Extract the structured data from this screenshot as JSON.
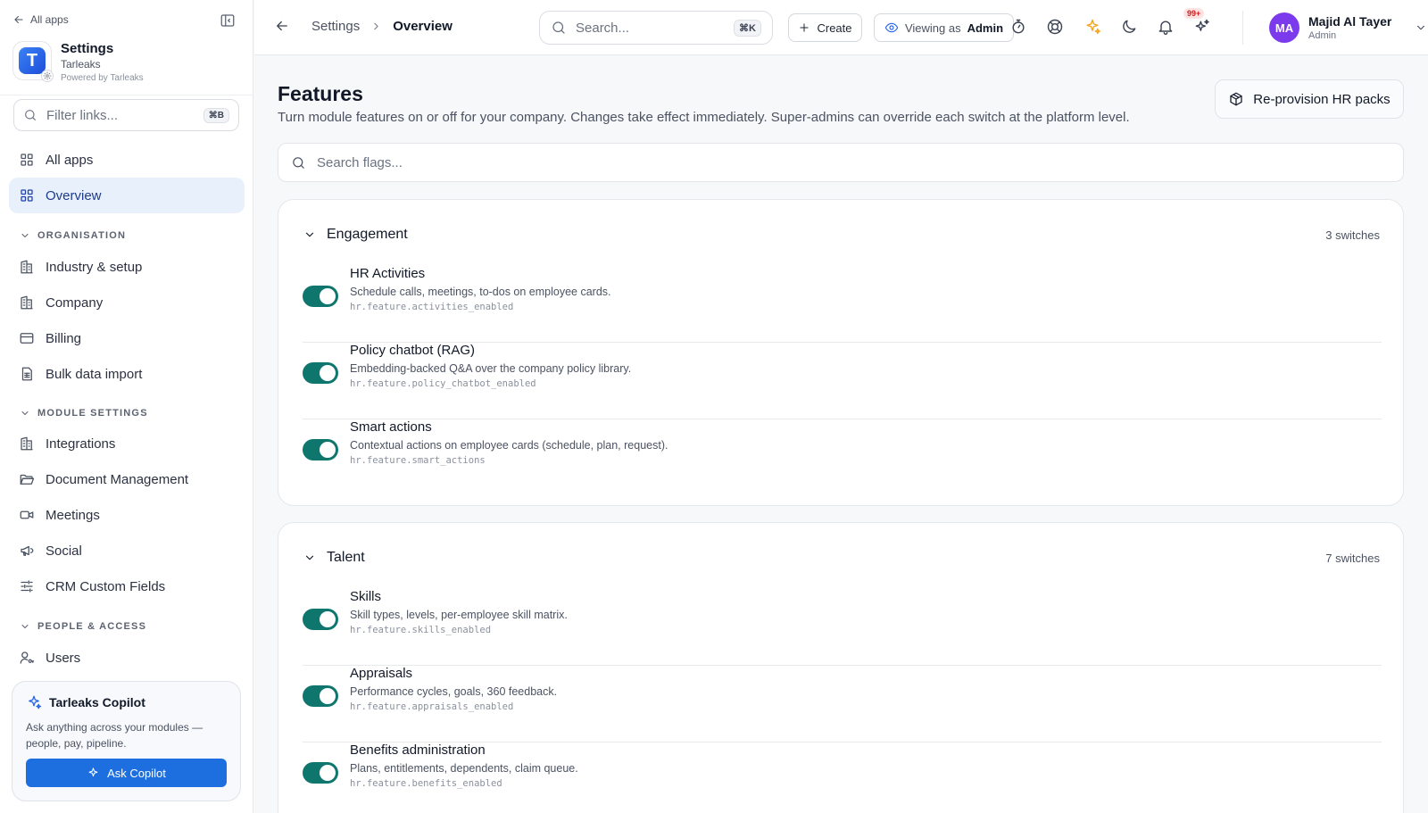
{
  "sidebar": {
    "back_label": "All apps",
    "brand": {
      "title": "Settings",
      "org": "Tarleaks",
      "powered": "Powered by Tarleaks",
      "logo_letter": "T"
    },
    "filter": {
      "placeholder": "Filter links...",
      "shortcut": "⌘B"
    },
    "items_top": [
      {
        "label": "All apps",
        "icon": "grid-icon"
      },
      {
        "label": "Overview",
        "icon": "grid-icon",
        "active": true
      }
    ],
    "sections": [
      {
        "label": "ORGANISATION",
        "items": [
          "Industry & setup",
          "Company",
          "Billing",
          "Bulk data import"
        ]
      },
      {
        "label": "MODULE SETTINGS",
        "items": [
          "Integrations",
          "Document Management",
          "Meetings",
          "Social",
          "CRM Custom Fields"
        ]
      },
      {
        "label": "PEOPLE & ACCESS",
        "items": [
          "Users"
        ]
      }
    ],
    "copilot": {
      "title": "Tarleaks Copilot",
      "description": "Ask anything across your modules — people, pay, pipeline.",
      "button": "Ask Copilot"
    }
  },
  "topbar": {
    "breadcrumb": [
      "Settings",
      "Overview"
    ],
    "search": {
      "placeholder": "Search...",
      "shortcut": "⌘K"
    },
    "create_label": "Create",
    "viewing_label": "Viewing as",
    "viewing_role": "Admin",
    "notification_count": "99+",
    "user": {
      "initials": "MA",
      "name": "Majid Al Tayer",
      "role": "Admin"
    }
  },
  "main": {
    "title": "Features",
    "description": "Turn module features on or off for your company. Changes take effect immediately. Super-admins can override each switch at the platform level.",
    "reprovision_label": "Re-provision HR packs",
    "flag_search_placeholder": "Search flags...",
    "groups": [
      {
        "name": "Engagement",
        "count": "3 switches",
        "flags": [
          {
            "name": "HR Activities",
            "desc": "Schedule calls, meetings, to-dos on employee cards.",
            "key": "hr.feature.activities_enabled",
            "on": true
          },
          {
            "name": "Policy chatbot (RAG)",
            "desc": "Embedding-backed Q&A over the company policy library.",
            "key": "hr.feature.policy_chatbot_enabled",
            "on": true
          },
          {
            "name": "Smart actions",
            "desc": "Contextual actions on employee cards (schedule, plan, request).",
            "key": "hr.feature.smart_actions",
            "on": true
          }
        ]
      },
      {
        "name": "Talent",
        "count": "7 switches",
        "flags": [
          {
            "name": "Skills",
            "desc": "Skill types, levels, per-employee skill matrix.",
            "key": "hr.feature.skills_enabled",
            "on": true
          },
          {
            "name": "Appraisals",
            "desc": "Performance cycles, goals, 360 feedback.",
            "key": "hr.feature.appraisals_enabled",
            "on": true
          },
          {
            "name": "Benefits administration",
            "desc": "Plans, entitlements, dependents, claim queue.",
            "key": "hr.feature.benefits_enabled",
            "on": true
          }
        ]
      }
    ]
  },
  "colors": {
    "accent": "#1d6fe0",
    "toggle_on": "#0f766e",
    "avatar": "#7c3aed",
    "sparkle": "#f5a524"
  }
}
